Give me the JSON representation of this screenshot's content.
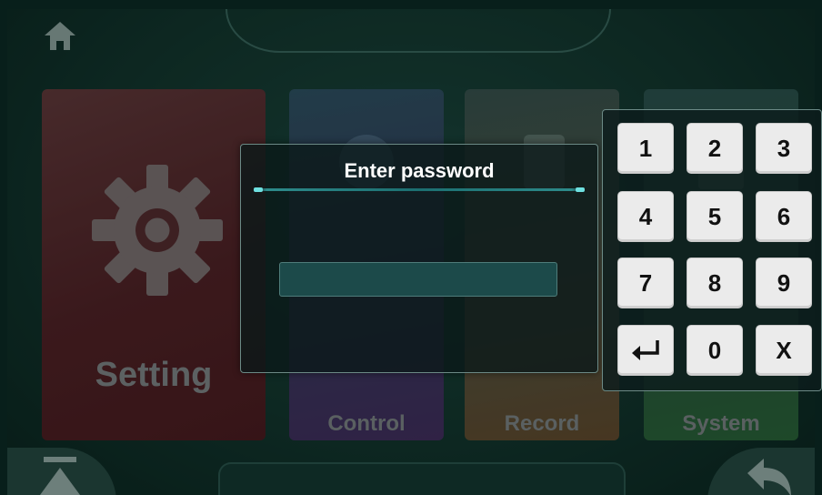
{
  "tiles": {
    "setting_label": "Setting",
    "control_label": "Control",
    "record_label": "Record",
    "system_label": "System"
  },
  "dialog": {
    "title": "Enter password",
    "password_value": ""
  },
  "keypad": {
    "keys": [
      "1",
      "2",
      "3",
      "4",
      "5",
      "6",
      "7",
      "8",
      "9",
      "enter",
      "0",
      "X"
    ],
    "enter_icon": "enter-arrow-icon"
  },
  "icons": {
    "home": "home-icon",
    "top": "eject-icon",
    "back": "back-arrow-icon",
    "setting": "gear-icon"
  },
  "colors": {
    "background": "#153830",
    "setting_tile": "#5a2127",
    "control_tile": "#3d3e66",
    "record_tile": "#6d4e2f",
    "system_tile": "#2f6a3b",
    "key_face": "#ebebeb"
  }
}
